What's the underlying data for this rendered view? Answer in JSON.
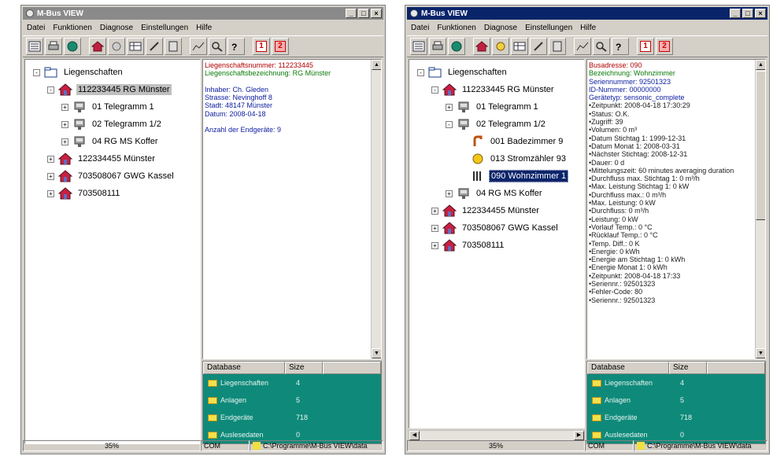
{
  "windows": [
    {
      "title": "M-Bus VIEW",
      "menu": [
        "Datei",
        "Funktionen",
        "Diagnose",
        "Einstellungen",
        "Hilfe"
      ],
      "toolbar_numbers": [
        "1",
        "2"
      ],
      "tree": [
        {
          "label": "Liegenschaften",
          "level": 0,
          "expand": "-",
          "icon": "folder-tree-icon"
        },
        {
          "label": "112233445 RG Münster",
          "level": 1,
          "expand": "-",
          "icon": "house-icon",
          "selected": true
        },
        {
          "label": "01 Telegramm 1",
          "level": 2,
          "expand": "+",
          "icon": "meter-device-icon"
        },
        {
          "label": "02 Telegramm 1/2",
          "level": 2,
          "expand": "+",
          "icon": "meter-device-icon"
        },
        {
          "label": "04 RG MS Koffer",
          "level": 2,
          "expand": "+",
          "icon": "meter-device-icon"
        },
        {
          "label": "122334455 Münster",
          "level": 1,
          "expand": "+",
          "icon": "house-icon"
        },
        {
          "label": "703508067 GWG Kassel",
          "level": 1,
          "expand": "+",
          "icon": "house-icon"
        },
        {
          "label": "703508111",
          "level": 1,
          "expand": "+",
          "icon": "house-icon"
        }
      ],
      "details": [
        {
          "label": "Liegenschaftsnummer:",
          "value": "112233445",
          "color": "red"
        },
        {
          "label": "Liegenschaftsbezeichnung:",
          "value": "RG Münster",
          "color": "green"
        },
        {
          "label": "",
          "value": "",
          "color": "dark"
        },
        {
          "label": "Inhaber:",
          "value": "Ch. Gleden",
          "color": "blue"
        },
        {
          "label": "Strasse:",
          "value": "Nevinghoff 8",
          "color": "blue"
        },
        {
          "label": "Stadt:",
          "value": "48147 Münster",
          "color": "blue"
        },
        {
          "label": "Datum:",
          "value": "2008-04-18",
          "color": "blue"
        },
        {
          "label": "",
          "value": "",
          "color": "dark"
        },
        {
          "label": "Anzahl der Endgeräte:",
          "value": "9",
          "color": "blue"
        }
      ],
      "database": {
        "headers": [
          "Database",
          "Size"
        ],
        "rows": [
          {
            "name": "Liegenschaften",
            "size": "4"
          },
          {
            "name": "Anlagen",
            "size": "5"
          },
          {
            "name": "Endgeräte",
            "size": "718"
          },
          {
            "name": "Auslesedaten",
            "size": "0"
          }
        ]
      },
      "status": [
        "35%",
        "COM",
        "C:\\Programme\\M-Bus VIEW\\data"
      ]
    },
    {
      "title": "M-Bus VIEW",
      "menu": [
        "Datei",
        "Funktionen",
        "Diagnose",
        "Einstellungen",
        "Hilfe"
      ],
      "toolbar_numbers": [
        "1",
        "2"
      ],
      "tree": [
        {
          "label": "Liegenschaften",
          "level": 0,
          "expand": "-",
          "icon": "folder-tree-icon"
        },
        {
          "label": "112233445 RG Münster",
          "level": 1,
          "expand": "-",
          "icon": "house-icon"
        },
        {
          "label": "01 Telegramm 1",
          "level": 2,
          "expand": "+",
          "icon": "meter-device-icon"
        },
        {
          "label": "02 Telegramm 1/2",
          "level": 2,
          "expand": "-",
          "icon": "meter-device-icon"
        },
        {
          "label": "001 Badezimmer 9",
          "level": 3,
          "expand": "",
          "icon": "water-meter-icon"
        },
        {
          "label": "013 Stromzähler 93",
          "level": 3,
          "expand": "",
          "icon": "electricity-meter-icon"
        },
        {
          "label": "090 Wohnzimmer 1",
          "level": 3,
          "expand": "",
          "icon": "radiator-icon",
          "selected": true
        },
        {
          "label": "04 RG MS Koffer",
          "level": 2,
          "expand": "+",
          "icon": "meter-device-icon"
        },
        {
          "label": "122334455 Münster",
          "level": 1,
          "expand": "+",
          "icon": "house-icon"
        },
        {
          "label": "703508067 GWG Kassel",
          "level": 1,
          "expand": "+",
          "icon": "house-icon"
        },
        {
          "label": "703508111",
          "level": 1,
          "expand": "+",
          "icon": "house-icon"
        }
      ],
      "details": [
        {
          "label": "Busadresse:",
          "value": "090",
          "color": "red"
        },
        {
          "label": "Bezeichnung:",
          "value": "Wohnzimmer",
          "color": "green"
        },
        {
          "label": "Seriennummer:",
          "value": "92501323",
          "color": "blue"
        },
        {
          "label": "ID-Nummer:",
          "value": "00000000",
          "color": "blue"
        },
        {
          "label": "Gerätetyp:",
          "value": "sensonic_complete",
          "color": "blue"
        },
        {
          "label": "•Zeitpunkt:",
          "value": "2008-04-18 17:30:29",
          "color": "dark"
        },
        {
          "label": "•Status:",
          "value": "O.K.",
          "color": "dark"
        },
        {
          "label": "•Zugriff:",
          "value": "39",
          "color": "dark"
        },
        {
          "label": "•Volumen:",
          "value": "0 m³",
          "color": "dark"
        },
        {
          "label": "•Datum Stichtag 1:",
          "value": "1999-12-31",
          "color": "dark"
        },
        {
          "label": "•Datum Monat 1:",
          "value": "2008-03-31",
          "color": "dark"
        },
        {
          "label": "•Nächster Stichtag:",
          "value": "2008-12-31",
          "color": "dark"
        },
        {
          "label": "•Dauer:",
          "value": "0 d",
          "color": "dark"
        },
        {
          "label": "•Mittelungszeit:",
          "value": "60 minutes averaging duration",
          "color": "dark"
        },
        {
          "label": "•Durchfluss max. Stichtag 1:",
          "value": "0 m³/h",
          "color": "dark"
        },
        {
          "label": "•Max. Leistung Stichtag 1:",
          "value": "0 kW",
          "color": "dark"
        },
        {
          "label": "•Durchfluss max.:",
          "value": "0 m³/h",
          "color": "dark"
        },
        {
          "label": "•Max. Leistung:",
          "value": "0 kW",
          "color": "dark"
        },
        {
          "label": "•Durchfluss:",
          "value": "0 m³/h",
          "color": "dark"
        },
        {
          "label": "•Leistung:",
          "value": "0 kW",
          "color": "dark"
        },
        {
          "label": "•Vorlauf Temp.:",
          "value": "0 °C",
          "color": "dark"
        },
        {
          "label": "•Rücklauf Temp.:",
          "value": "0 °C",
          "color": "dark"
        },
        {
          "label": "•Temp. Diff.:",
          "value": "0 K",
          "color": "dark"
        },
        {
          "label": "•Energie:",
          "value": "0 kWh",
          "color": "dark"
        },
        {
          "label": "•Energie am Stichtag 1:",
          "value": "0 kWh",
          "color": "dark"
        },
        {
          "label": "•Energie Monat 1:",
          "value": "0 kWh",
          "color": "dark"
        },
        {
          "label": "•Zeitpunkt:",
          "value": "2008-04-18 17:33",
          "color": "dark"
        },
        {
          "label": "•Seriennr.:",
          "value": "92501323",
          "color": "dark"
        },
        {
          "label": "•Fehler-Code:",
          "value": "80",
          "color": "dark"
        },
        {
          "label": "•Seriennr.:",
          "value": "92501323",
          "color": "dark"
        }
      ],
      "database": {
        "headers": [
          "Database",
          "Size"
        ],
        "rows": [
          {
            "name": "Liegenschaften",
            "size": "4"
          },
          {
            "name": "Anlagen",
            "size": "5"
          },
          {
            "name": "Endgeräte",
            "size": "718"
          },
          {
            "name": "Auslesedaten",
            "size": "0"
          }
        ]
      },
      "status": [
        "35%",
        "COM",
        "C:\\Programme\\M-Bus VIEW\\data"
      ]
    }
  ],
  "colors": {
    "active_title": "#0a246a",
    "inactive_title": "#8a8a8a",
    "database_panel": "#0f8a7a",
    "detail_red": "#b00000",
    "detail_green": "#0a7a0a",
    "detail_blue": "#1020a0"
  }
}
